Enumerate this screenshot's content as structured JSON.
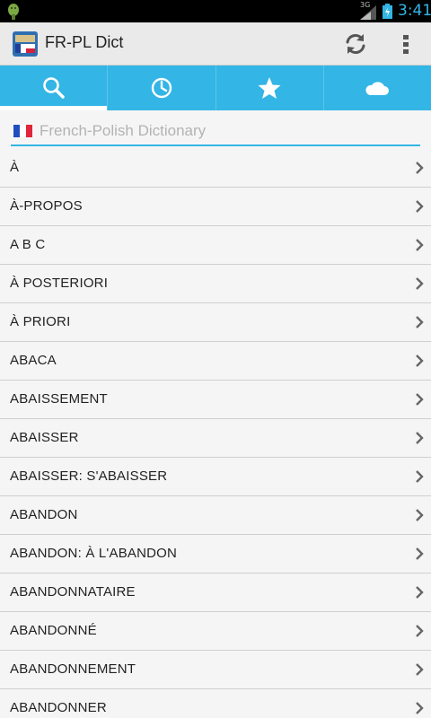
{
  "status_bar": {
    "network": "3G",
    "time": "3:41",
    "icons": [
      "android-icon",
      "signal-icon",
      "battery-icon"
    ]
  },
  "action_bar": {
    "title": "FR-PL Dict",
    "icons": [
      "app-icon",
      "refresh-icon",
      "overflow-menu-icon"
    ]
  },
  "tabs": [
    {
      "icon": "search-icon",
      "active": true
    },
    {
      "icon": "clock-icon",
      "active": false
    },
    {
      "icon": "star-icon",
      "active": false
    },
    {
      "icon": "cloud-icon",
      "active": false
    }
  ],
  "search": {
    "placeholder": "French-Polish Dictionary",
    "value": ""
  },
  "words": [
    "À",
    "À-PROPOS",
    "A B C",
    "À POSTERIORI",
    "À PRIORI",
    "ABACA",
    "ABAISSEMENT",
    "ABAISSER",
    "ABAISSER: S'ABAISSER",
    "ABANDON",
    "ABANDON: À L'ABANDON",
    "ABANDONNATAIRE",
    "ABANDONNÉ",
    "ABANDONNEMENT",
    "ABANDONNER"
  ],
  "colors": {
    "accent": "#33b5e5",
    "action_bar": "#eaeaea",
    "background": "#f5f5f5",
    "divider": "#cfcfcf"
  }
}
